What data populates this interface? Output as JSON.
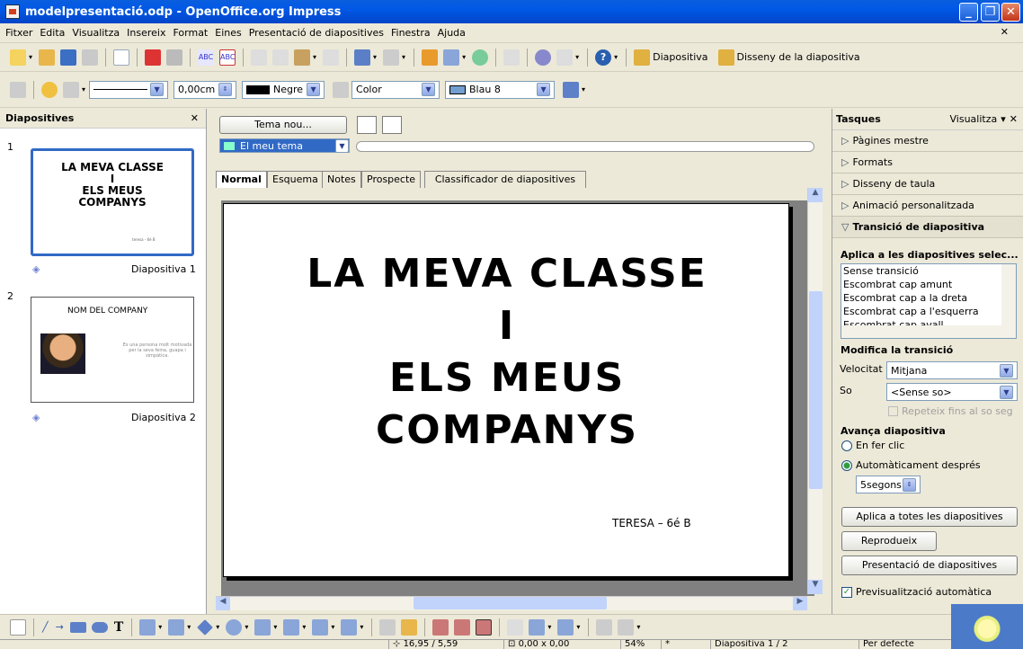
{
  "window": {
    "title": "modelpresentació.odp - OpenOffice.org Impress"
  },
  "menu": [
    "Fitxer",
    "Edita",
    "Visualitza",
    "Insereix",
    "Format",
    "Eines",
    "Presentació de diapositives",
    "Finestra",
    "Ajuda"
  ],
  "toolbar": {
    "diapositiva_label": "Diapositiva",
    "disseny_label": "Disseny de la diapositiva"
  },
  "format": {
    "line_width": "0,00cm",
    "line_color": "Negre",
    "fill_type": "Color",
    "fill_color": "Blau 8",
    "swatch_line": "#000000",
    "swatch_fill": "#729fcf"
  },
  "left_panel": {
    "title": "Diapositives",
    "slides": [
      {
        "number": "1",
        "lines": [
          "LA MEVA CLASSE",
          "I",
          "ELS MEUS",
          "COMPANYS"
        ],
        "footer": "teresa - 6é B",
        "label": "Diapositiva 1"
      },
      {
        "number": "2",
        "title": "NOM DEL COMPANY",
        "body": "Es una persona molt motivada per la seva feina, guapa i simpàtica.",
        "label": "Diapositiva 2"
      }
    ]
  },
  "center": {
    "theme_button": "Tema nou...",
    "theme_select": "El meu tema",
    "tabs": [
      "Normal",
      "Esquema",
      "Notes",
      "Prospecte",
      "Classificador de diapositives"
    ],
    "slide": {
      "lines": [
        "LA MEVA CLASSE",
        "I",
        "ELS MEUS",
        "COMPANYS"
      ],
      "footer": "TERESA – 6é B"
    }
  },
  "right_panel": {
    "title": "Tasques",
    "view_label": "Visualitza",
    "sections": [
      "Pàgines mestre",
      "Formats",
      "Disseny de taula",
      "Animació personalitzada"
    ],
    "open_section": "Transició de diapositiva",
    "apply_label": "Aplica a les diapositives selec...",
    "transitions": [
      "Sense transició",
      "Escombrat cap amunt",
      "Escombrat cap a la dreta",
      "Escombrat cap a l'esquerra",
      "Escombrat cap avall"
    ],
    "modify_label": "Modifica la transició",
    "speed_label": "Velocitat",
    "speed_value": "Mitjana",
    "sound_label": "So",
    "sound_value": "<Sense so>",
    "repeat_label": "Repeteix fins al so seg",
    "advance_label": "Avança diapositiva",
    "on_click_label": "En fer clic",
    "auto_label": "Automàticament després",
    "auto_value": "5segons",
    "apply_all_button": "Aplica a totes les diapositives",
    "play_button": "Reprodueix",
    "show_button": "Presentació de diapositives",
    "preview_label": "Previsualització automàtica"
  },
  "status": {
    "position": "16,95 / 5,59",
    "size": "0,00 x 0,00",
    "zoom": "54%",
    "modified": "*",
    "slide": "Diapositiva 1 / 2",
    "layout": "Per defecte"
  }
}
